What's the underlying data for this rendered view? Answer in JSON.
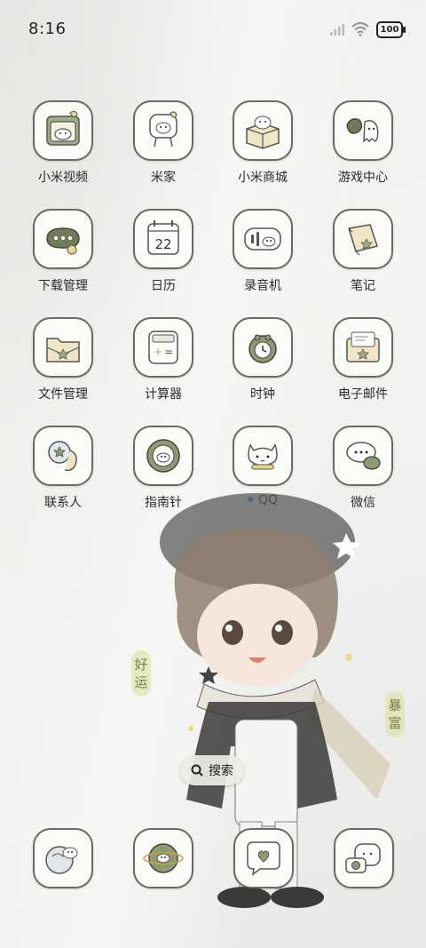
{
  "status_bar": {
    "time": "8:16",
    "battery": "100"
  },
  "apps": [
    {
      "label": "小米视频",
      "icon": "video-icon"
    },
    {
      "label": "米家",
      "icon": "mijia-icon"
    },
    {
      "label": "小米商城",
      "icon": "shop-box-icon"
    },
    {
      "label": "游戏中心",
      "icon": "game-center-icon"
    },
    {
      "label": "下载管理",
      "icon": "download-icon"
    },
    {
      "label": "日历",
      "icon": "calendar-icon",
      "day": "22"
    },
    {
      "label": "录音机",
      "icon": "recorder-icon"
    },
    {
      "label": "笔记",
      "icon": "notes-icon"
    },
    {
      "label": "文件管理",
      "icon": "file-manager-icon"
    },
    {
      "label": "计算器",
      "icon": "calculator-icon"
    },
    {
      "label": "时钟",
      "icon": "clock-icon"
    },
    {
      "label": "电子邮件",
      "icon": "email-icon"
    },
    {
      "label": "联系人",
      "icon": "contacts-icon"
    },
    {
      "label": "指南针",
      "icon": "compass-icon"
    },
    {
      "label": "QQ",
      "icon": "qq-icon"
    },
    {
      "label": "微信",
      "icon": "wechat-icon"
    }
  ],
  "search": {
    "label": "搜索"
  },
  "side_tags": {
    "left": "好运",
    "right": "暴富"
  },
  "dock": [
    {
      "icon": "phone-icon"
    },
    {
      "icon": "browser-icon"
    },
    {
      "icon": "messages-icon"
    },
    {
      "icon": "camera-icon"
    }
  ]
}
